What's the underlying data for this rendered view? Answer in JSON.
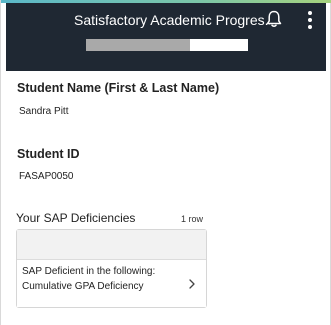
{
  "header": {
    "title": "Satisfactory Academic Progres...",
    "progress_percent": 64
  },
  "student_name": {
    "label": "Student Name (First & Last Name)",
    "value": "Sandra Pitt"
  },
  "student_id": {
    "label": "Student ID",
    "value": "FASAP0050"
  },
  "deficiencies": {
    "title": "Your SAP Deficiencies",
    "row_count": "1 row",
    "rows": [
      {
        "line1": "SAP Deficient in the following:",
        "line2": "Cumulative GPA Deficiency"
      }
    ]
  },
  "colors": {
    "header_bg": "#1f2833",
    "accent_start": "#5bb8c9",
    "accent_end": "#a7d37d",
    "progress_fill": "#a9a9a9"
  },
  "icons": {
    "notifications": "bell-icon",
    "menu": "more-vertical-icon",
    "row_action": "chevron-right-icon"
  }
}
